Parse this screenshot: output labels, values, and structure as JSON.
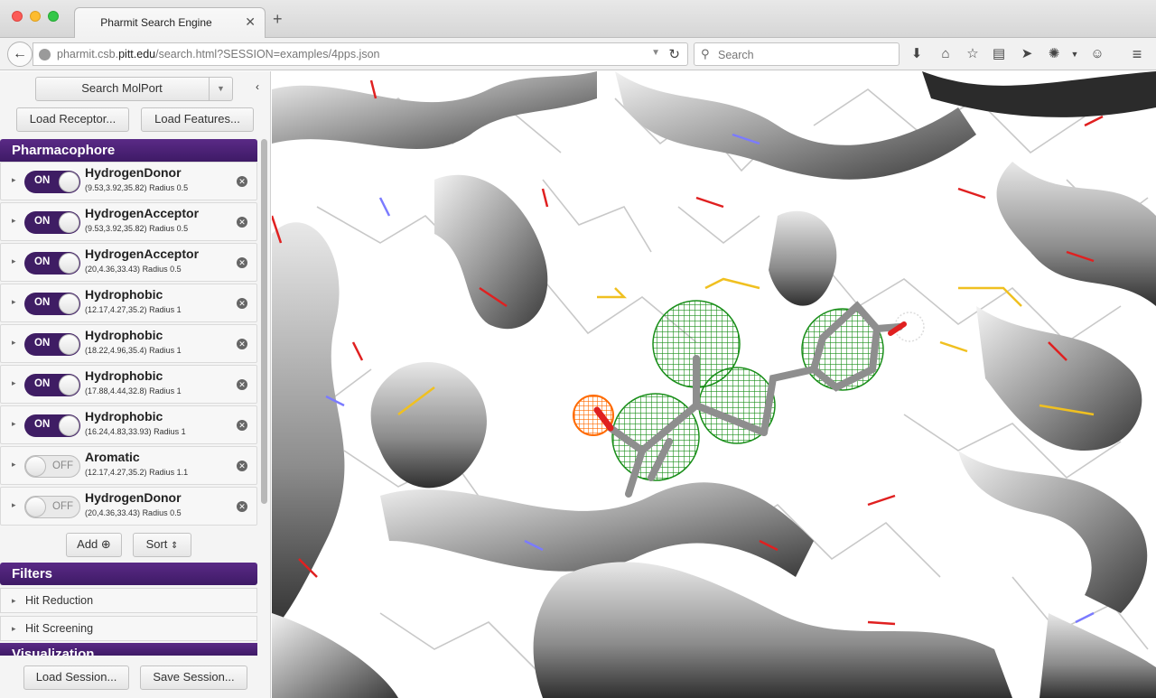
{
  "browser": {
    "tab_title": "Pharmit Search Engine",
    "tab_close": "✕",
    "new_tab": "+",
    "url_prefix": "pharmit.csb.",
    "url_host": "pitt.edu",
    "url_path": "/search.html?SESSION=examples/4pps.json",
    "search_placeholder": "Search"
  },
  "sidebar": {
    "search_button": "Search MolPort",
    "load_receptor": "Load Receptor...",
    "load_features": "Load Features...",
    "pharmacophore_title": "Pharmacophore",
    "features": [
      {
        "state": "ON",
        "name": "HydrogenDonor",
        "coords": "(9.53,3.92,35.82)",
        "radius": "Radius 0.5"
      },
      {
        "state": "ON",
        "name": "HydrogenAcceptor",
        "coords": "(9.53,3.92,35.82)",
        "radius": "Radius 0.5"
      },
      {
        "state": "ON",
        "name": "HydrogenAcceptor",
        "coords": "(20,4.36,33.43)",
        "radius": "Radius 0.5"
      },
      {
        "state": "ON",
        "name": "Hydrophobic",
        "coords": "(12.17,4.27,35.2)",
        "radius": "Radius 1"
      },
      {
        "state": "ON",
        "name": "Hydrophobic",
        "coords": "(18.22,4.96,35.4)",
        "radius": "Radius 1"
      },
      {
        "state": "ON",
        "name": "Hydrophobic",
        "coords": "(17.88,4.44,32.8)",
        "radius": "Radius 1"
      },
      {
        "state": "ON",
        "name": "Hydrophobic",
        "coords": "(16.24,4.83,33.93)",
        "radius": "Radius 1"
      },
      {
        "state": "OFF",
        "name": "Aromatic",
        "coords": "(12.17,4.27,35.2)",
        "radius": "Radius 1.1"
      },
      {
        "state": "OFF",
        "name": "HydrogenDonor",
        "coords": "(20,4.36,33.43)",
        "radius": "Radius 0.5"
      }
    ],
    "add_button": "Add",
    "sort_button": "Sort",
    "filters_title": "Filters",
    "filters": [
      "Hit Reduction",
      "Hit Screening"
    ],
    "visualization_title": "Visualization",
    "load_session": "Load Session...",
    "save_session": "Save Session..."
  },
  "colors": {
    "accent_purple": "#3f1d64",
    "hydrophobic_green": "#1f8a1f",
    "acceptor_orange": "#ff6a00"
  }
}
